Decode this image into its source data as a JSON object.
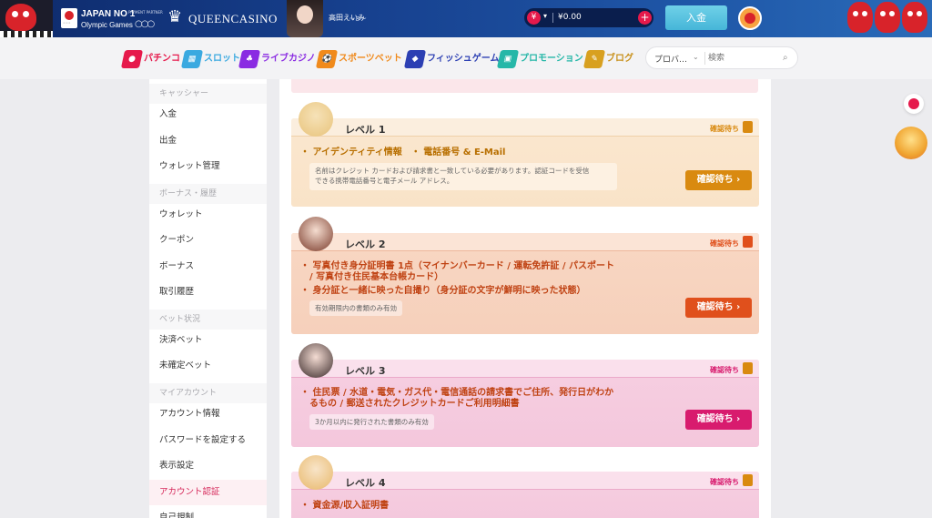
{
  "header": {
    "olympic_title": "JAPAN NO 1",
    "olympic_subtitle": "Olympic Games",
    "olympic_small": "PAYMENT PARTNER",
    "brand": "QUEENCASINO",
    "ambassador_name": "高田えいみ",
    "balance": "¥0.00",
    "deposit_label": "入金"
  },
  "nav": {
    "items": [
      {
        "label": "パチンコ",
        "color": "#e6194b"
      },
      {
        "label": "スロット",
        "color": "#3aa9e0"
      },
      {
        "label": "ライブカジノ",
        "color": "#8a2be2"
      },
      {
        "label": "スポーツベット",
        "color": "#f08a1c"
      },
      {
        "label": "フィッシュゲーム",
        "color": "#2c3fb3"
      },
      {
        "label": "プロモーション",
        "color": "#26b7a8"
      },
      {
        "label": "ブログ",
        "color": "#d8a020"
      }
    ],
    "provider_label": "プロバ…",
    "search_placeholder": "検索"
  },
  "sidebar": {
    "sections": [
      {
        "title": "キャッシャー",
        "items": [
          "入金",
          "出金",
          "ウォレット管理"
        ]
      },
      {
        "title": "ボーナス・履歴",
        "items": [
          "ウォレット",
          "クーポン",
          "ボーナス",
          "取引履歴"
        ]
      },
      {
        "title": "ベット状況",
        "items": [
          "決済ベット",
          "未確定ベット"
        ]
      },
      {
        "title": "マイアカウント",
        "items": [
          "アカウント情報",
          "パスワードを設定する",
          "表示設定",
          "アカウント認証",
          "自己規制"
        ]
      }
    ],
    "active_item": "アカウント認証"
  },
  "levels": [
    {
      "title": "レベル 1",
      "status": "確認待ち",
      "requirements": [
        "・ アイデンティティ情報　・ 電話番号 & E-Mail"
      ],
      "note": "名前はクレジット カードおよび請求書と一致している必要があります。認証コードを受信\nできる携帯電話番号と電子メール アドレス。",
      "button": "確認待ち ›",
      "accent": "#d98a10"
    },
    {
      "title": "レベル 2",
      "status": "確認待ち",
      "requirements": [
        "・ 写真付き身分証明書 1点（マイナンバーカード / 運転免許証 / パスポート\n　/ 写真付き住民基本台帳カード）",
        "・ 身分証と一緒に映った自撮り（身分証の文字が鮮明に映った状態）"
      ],
      "note": "有効期限内の書類のみ有効",
      "button": "確認待ち ›",
      "accent": "#e0501c"
    },
    {
      "title": "レベル 3",
      "status": "確認待ち",
      "requirements": [
        "・ 住民票 / 水道・電気・ガス代・電信通話の請求書でご住所、発行日がわか\n　るもの / 郵送されたクレジットカードご利用明細書"
      ],
      "note": "3か月以内に発行された書類のみ有効",
      "button": "確認待ち ›",
      "accent": "#d81b6e"
    },
    {
      "title": "レベル 4",
      "status": "確認待ち",
      "requirements": [
        "・ 資金源/収入証明書"
      ],
      "note": "",
      "button": "",
      "accent": "#d81b6e"
    }
  ]
}
